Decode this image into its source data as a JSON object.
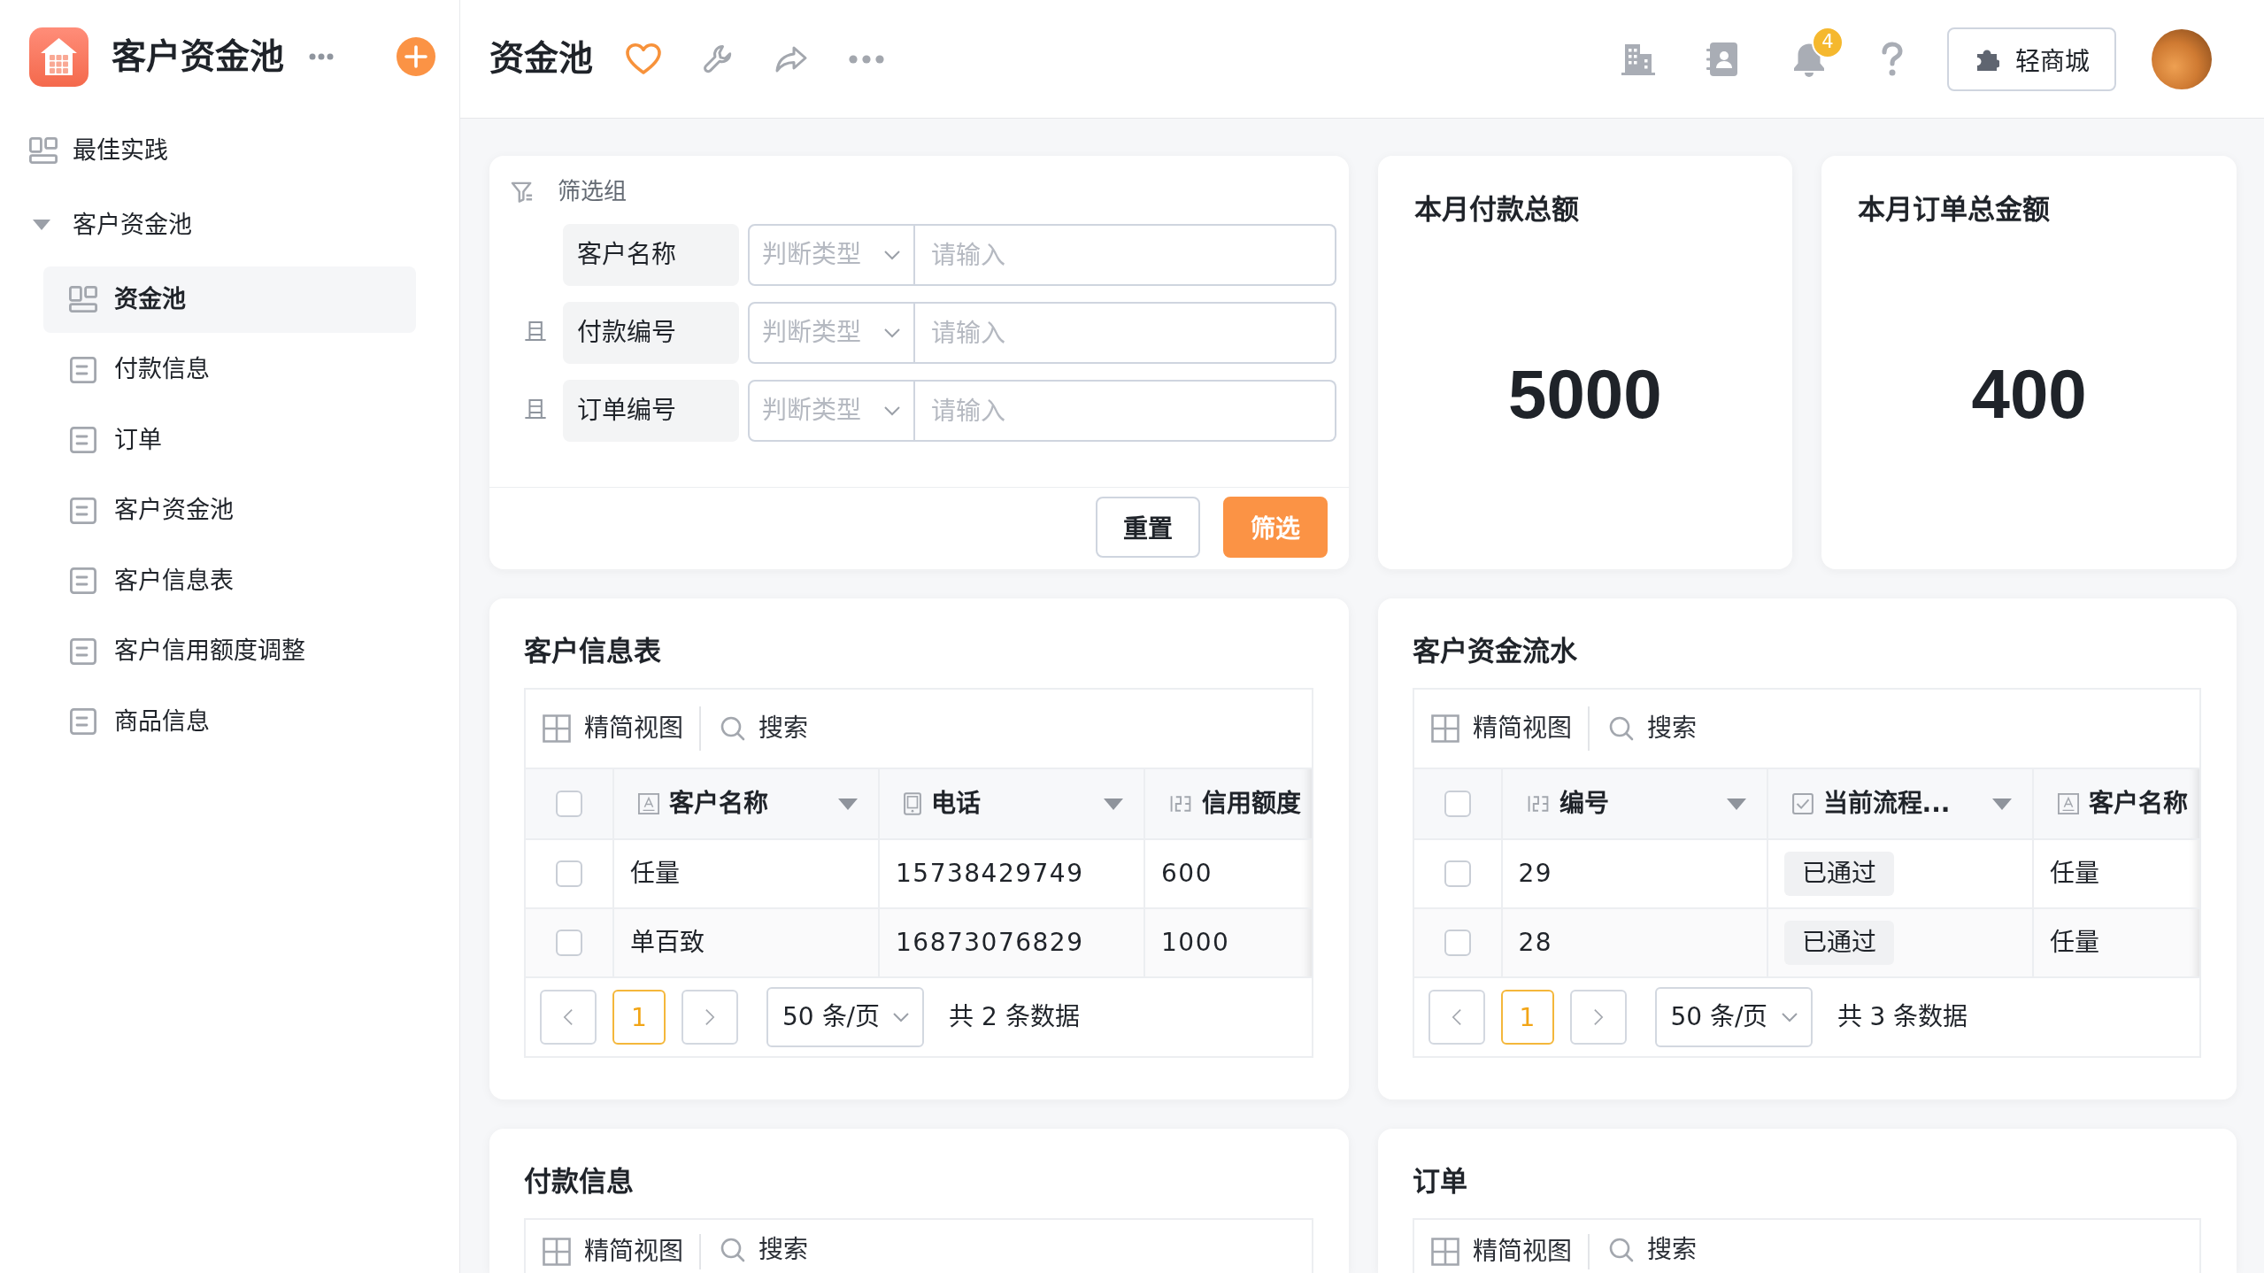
{
  "sidebar": {
    "app_title": "客户资金池",
    "nav": [
      {
        "label": "最佳实践",
        "kind": "dashboard",
        "selected": false
      },
      {
        "label": "客户资金池",
        "kind": "group",
        "selected": false,
        "expanded": true,
        "children": [
          {
            "label": "资金池",
            "kind": "dashboard",
            "selected": true
          },
          {
            "label": "付款信息",
            "kind": "form",
            "selected": false
          },
          {
            "label": "订单",
            "kind": "form",
            "selected": false
          },
          {
            "label": "客户资金池",
            "kind": "form",
            "selected": false
          },
          {
            "label": "客户信息表",
            "kind": "form",
            "selected": false
          },
          {
            "label": "客户信用额度调整",
            "kind": "form",
            "selected": false
          },
          {
            "label": "商品信息",
            "kind": "form",
            "selected": false
          }
        ]
      }
    ]
  },
  "header": {
    "title": "资金池",
    "notifications": "4",
    "store_button": "轻商城"
  },
  "filter": {
    "title": "筛选组",
    "conditions": [
      {
        "field": "客户名称",
        "operator": {
          "placeholder": "判断类型"
        },
        "value": {
          "placeholder": "请输入"
        }
      },
      {
        "connector": "且",
        "field": "付款编号",
        "operator": {
          "placeholder": "判断类型"
        },
        "value": {
          "placeholder": "请输入"
        }
      },
      {
        "connector": "且",
        "field": "订单编号",
        "operator": {
          "placeholder": "判断类型"
        },
        "value": {
          "placeholder": "请输入"
        }
      }
    ],
    "buttons": [
      {
        "label": "重置",
        "kind": "default"
      },
      {
        "label": "筛选",
        "kind": "primary"
      }
    ]
  },
  "stats": [
    {
      "title": "本月付款总额",
      "value": "5000"
    },
    {
      "title": "本月订单总金额",
      "value": "400"
    }
  ],
  "tables": [
    {
      "title": "客户信息表",
      "toolbar": {
        "view": "精简视图",
        "search": "搜索"
      },
      "select_all": {
        "checked": false
      },
      "columns": [
        {
          "label": "客户名称",
          "kind": "text",
          "menu": true
        },
        {
          "label": "电话",
          "kind": "phone",
          "menu": true
        },
        {
          "label": "信用额度",
          "kind": "number",
          "menu": false
        }
      ],
      "rows": [
        {
          "checked": false,
          "cells": [
            "任量",
            "15738429749",
            "600"
          ]
        },
        {
          "checked": false,
          "cells": [
            "单百致",
            "16873076829",
            "1000"
          ]
        }
      ],
      "pagination": {
        "pages": [
          {
            "label": "1",
            "selected": true
          }
        ],
        "page_size": "50 条/页",
        "total": "共 2 条数据"
      }
    },
    {
      "title": "客户资金流水",
      "toolbar": {
        "view": "精简视图",
        "search": "搜索"
      },
      "select_all": {
        "checked": false
      },
      "columns": [
        {
          "label": "编号",
          "kind": "number",
          "menu": true
        },
        {
          "label": "当前流程...",
          "kind": "flow",
          "menu": true
        },
        {
          "label": "客户名称",
          "kind": "text",
          "menu": false
        }
      ],
      "rows": [
        {
          "checked": false,
          "cells": [
            "29",
            "已通过",
            "任量"
          ]
        },
        {
          "checked": false,
          "cells": [
            "28",
            "已通过",
            "任量"
          ]
        }
      ],
      "pagination": {
        "pages": [
          {
            "label": "1",
            "selected": true
          }
        ],
        "page_size": "50 条/页",
        "total": "共 3 条数据"
      }
    },
    {
      "title": "付款信息",
      "toolbar": {
        "view": "精简视图",
        "search": "搜索"
      }
    },
    {
      "title": "订单",
      "toolbar": {
        "view": "精简视图",
        "search": "搜索"
      }
    }
  ]
}
